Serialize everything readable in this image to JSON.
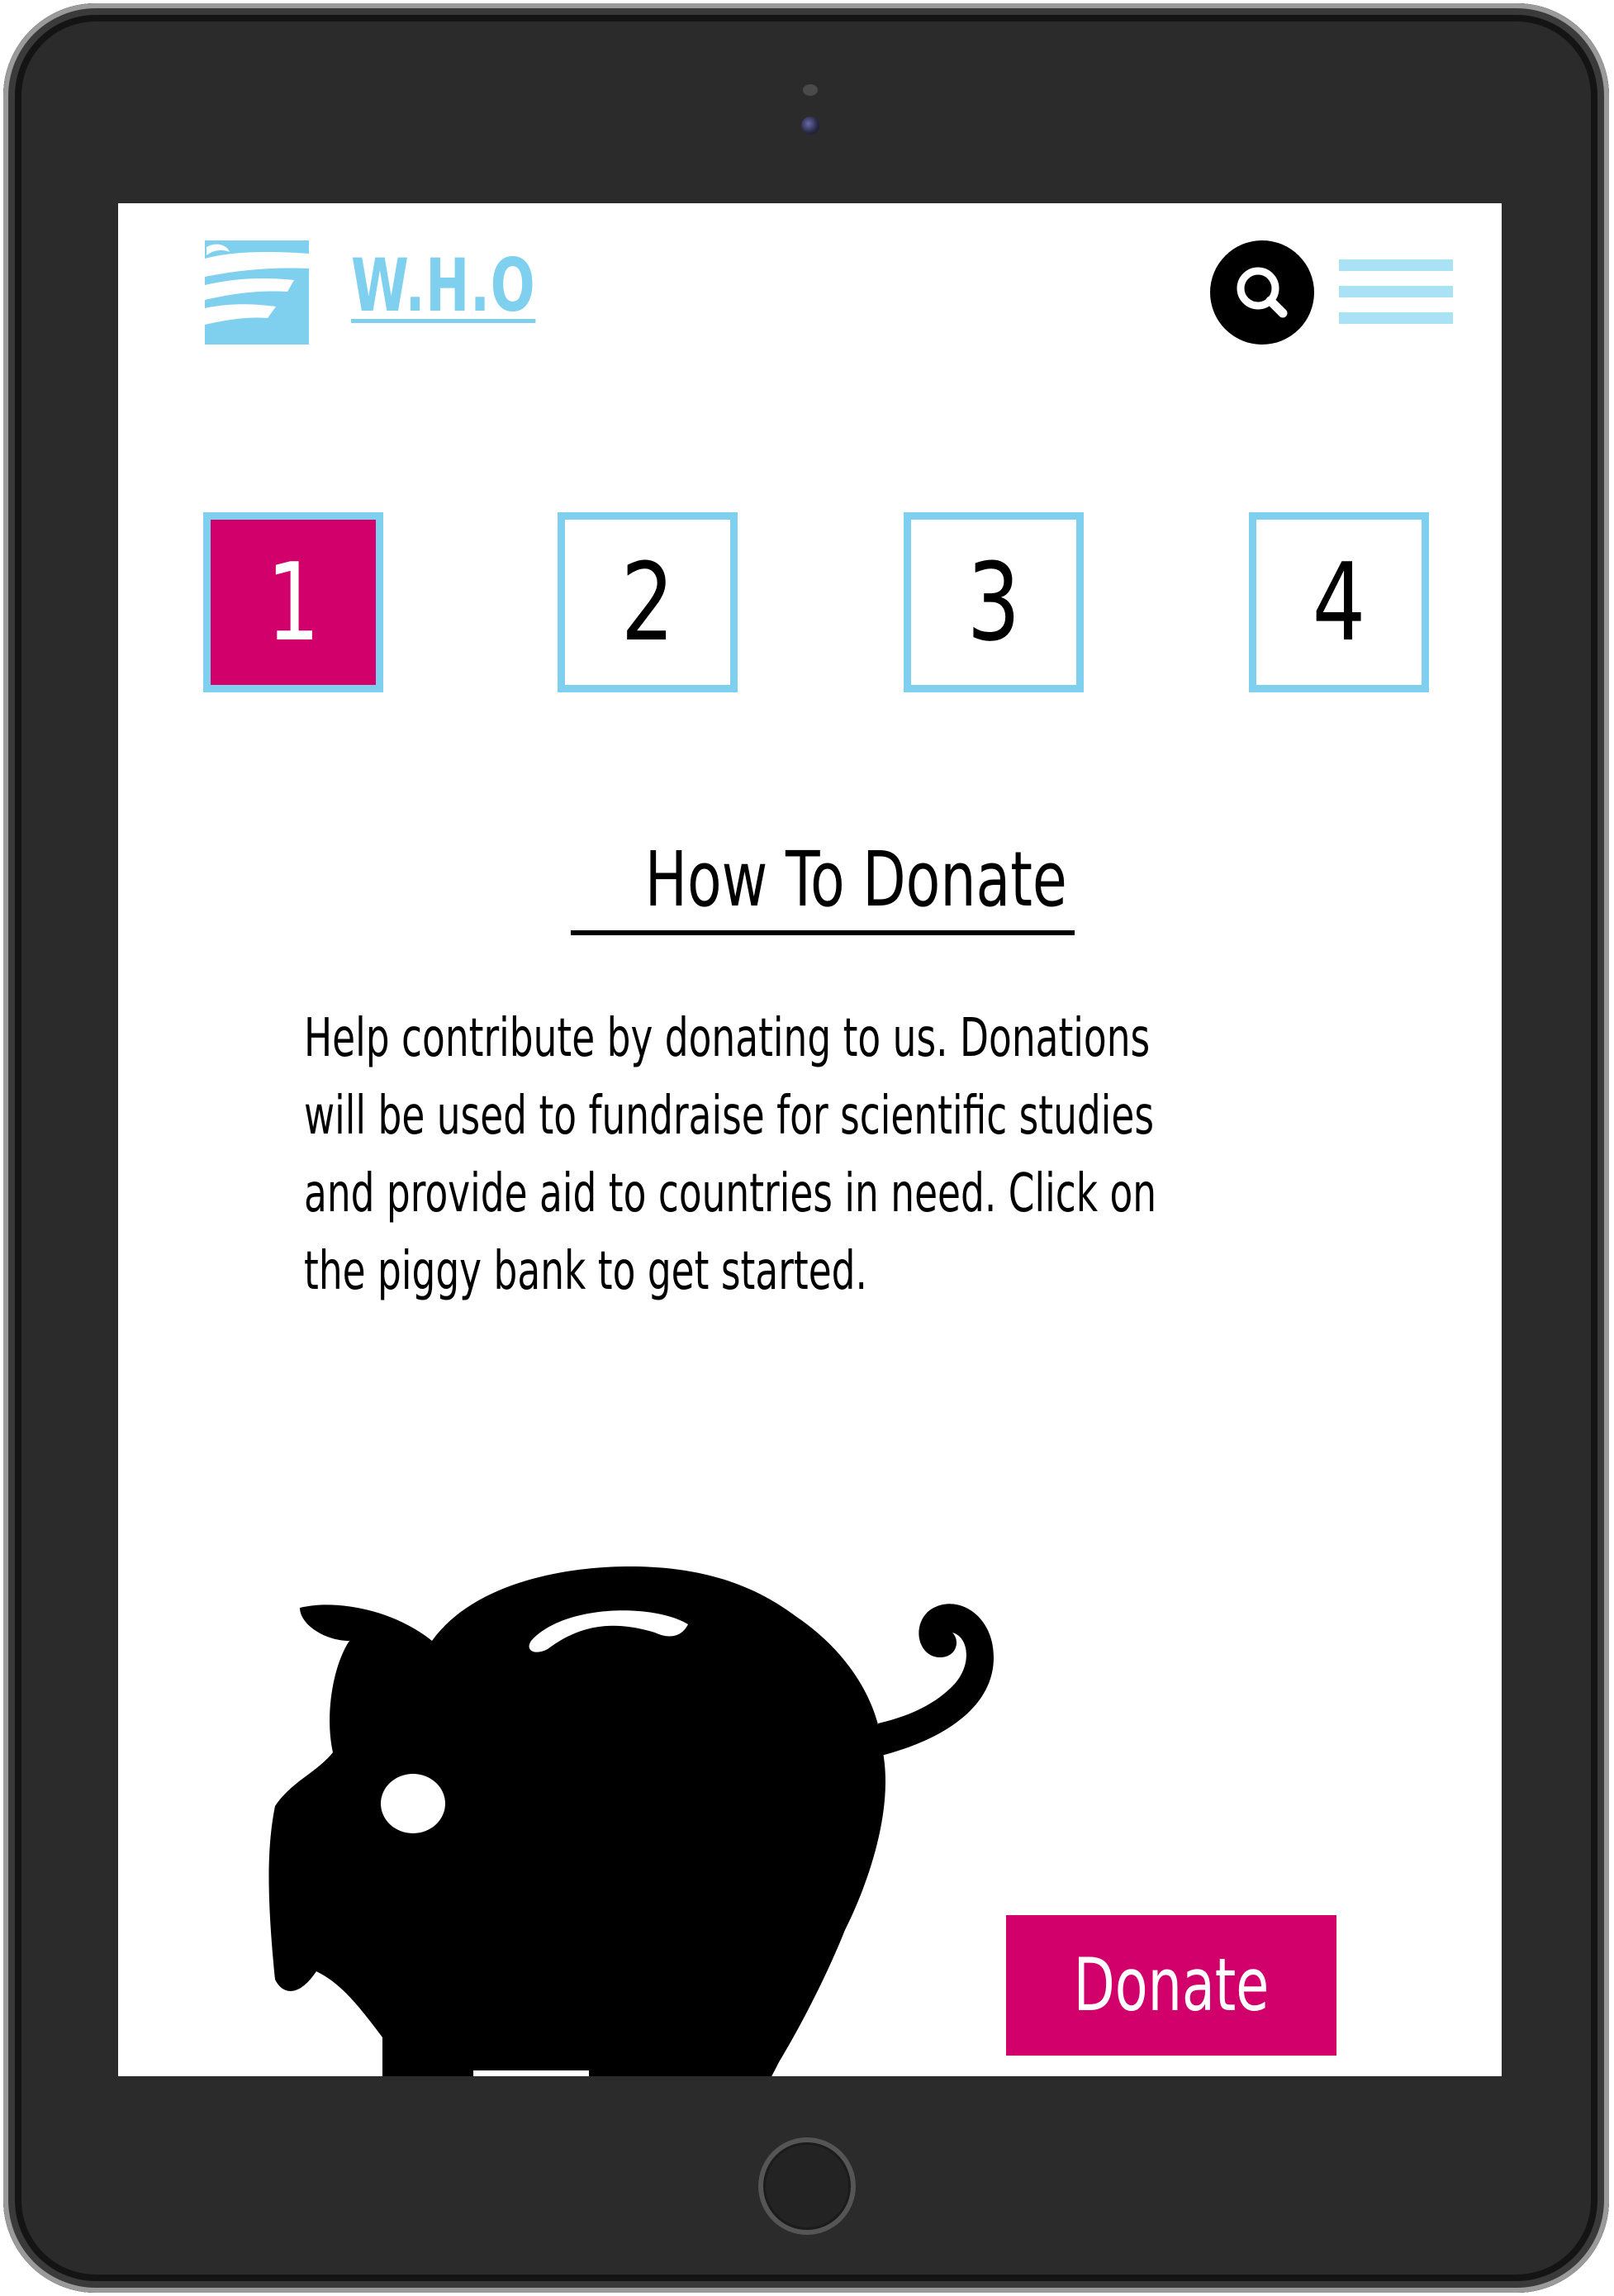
{
  "header": {
    "brand_text": "W.H.O",
    "logo_icon": "wing-icon",
    "search_icon": "search-icon",
    "menu_icon": "hamburger-menu-icon"
  },
  "steps": [
    {
      "label": "1",
      "active": true
    },
    {
      "label": "2",
      "active": false
    },
    {
      "label": "3",
      "active": false
    },
    {
      "label": "4",
      "active": false
    }
  ],
  "content": {
    "title": "How To Donate",
    "body_lines": [
      "Help contribute by donating to us. Donations",
      "will be used to fundraise for scientific studies",
      "and provide aid to countries in need. Click on",
      "the piggy bank to get started."
    ],
    "illustration": "piggy-bank-icon"
  },
  "actions": {
    "donate_label": "Donate"
  },
  "colors": {
    "accent_blue": "#7fd0ef",
    "accent_pink": "#d1006b",
    "text": "#000000",
    "background": "#ffffff"
  }
}
